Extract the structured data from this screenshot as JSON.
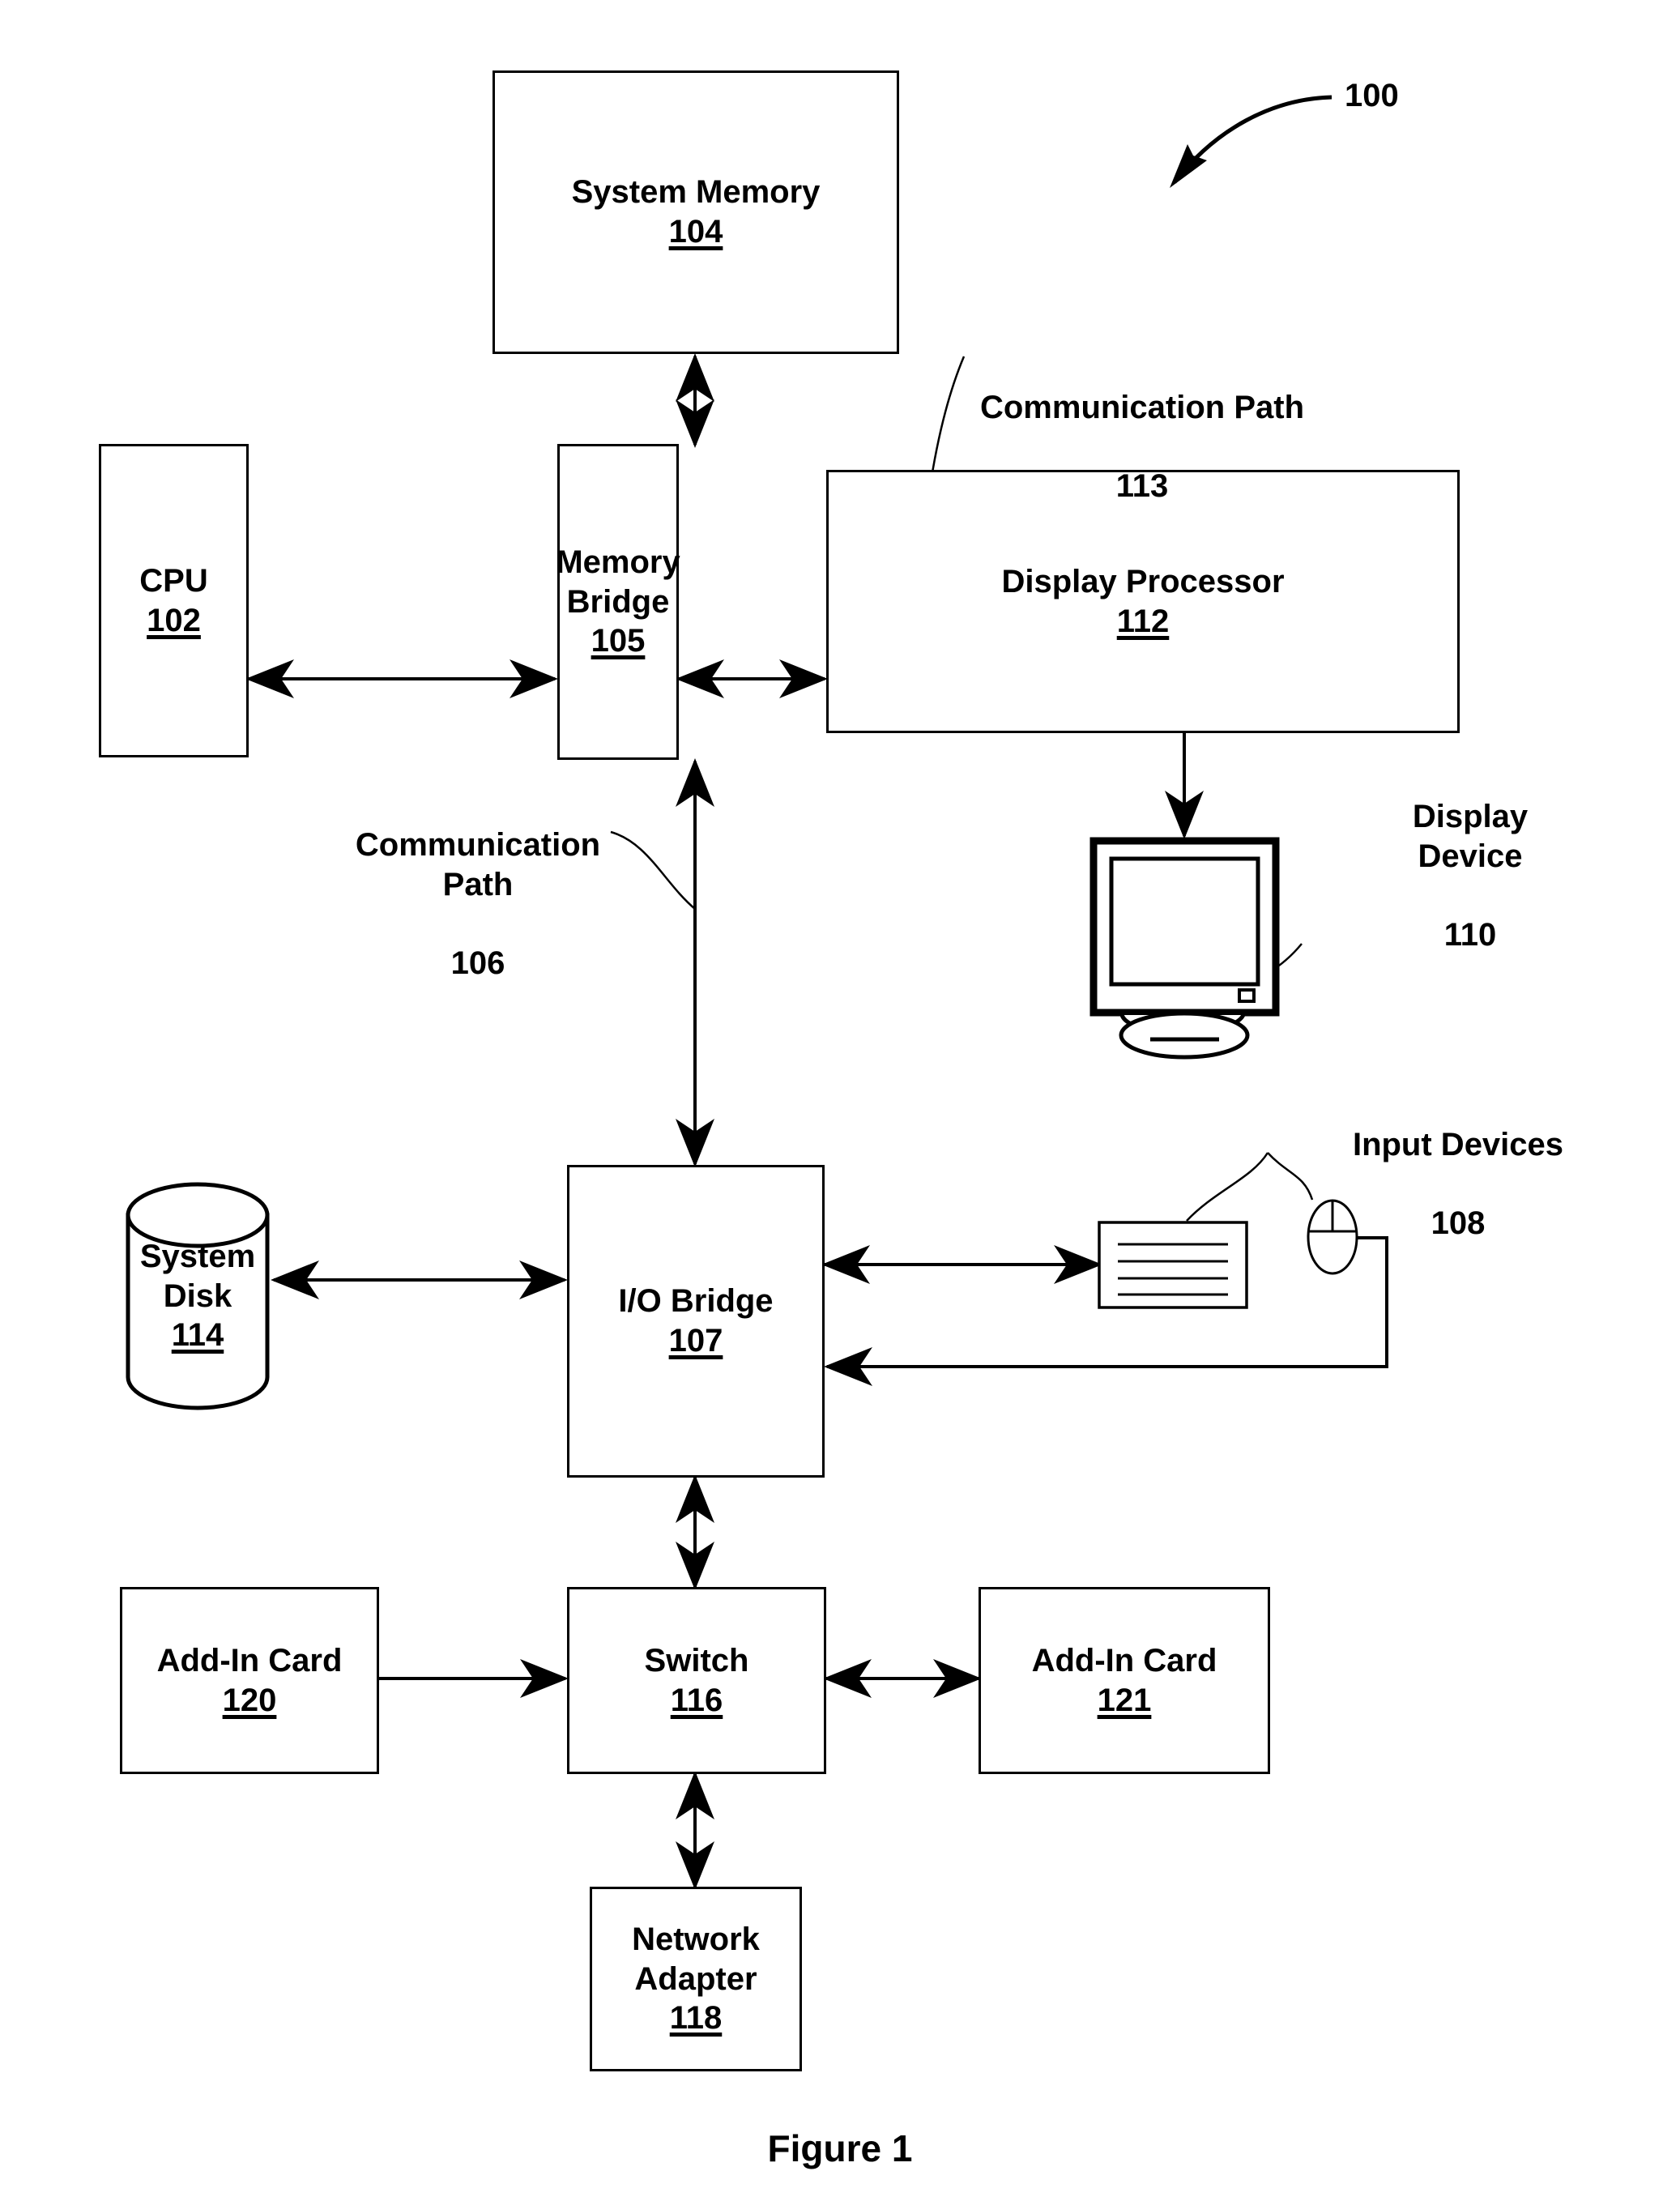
{
  "figure": {
    "caption": "Figure 1",
    "system_reference": "100"
  },
  "blocks": [
    {
      "id": "system-memory",
      "label": "System Memory",
      "number": "104"
    },
    {
      "id": "cpu",
      "label": "CPU",
      "number": "102"
    },
    {
      "id": "memory-bridge",
      "label": "Memory\nBridge",
      "number": "105"
    },
    {
      "id": "display-processor",
      "label": "Display Processor",
      "number": "112"
    },
    {
      "id": "io-bridge",
      "label": "I/O Bridge",
      "number": "107"
    },
    {
      "id": "system-disk",
      "label": "System\nDisk",
      "number": "114"
    },
    {
      "id": "switch",
      "label": "Switch",
      "number": "116"
    },
    {
      "id": "add-in-card-120",
      "label": "Add-In Card",
      "number": "120"
    },
    {
      "id": "add-in-card-121",
      "label": "Add-In Card",
      "number": "121"
    },
    {
      "id": "network-adapter",
      "label": "Network\nAdapter",
      "number": "118"
    }
  ],
  "annotations": [
    {
      "id": "communication-path-113",
      "label": "Communication Path",
      "number": "113"
    },
    {
      "id": "communication-path-106",
      "label": "Communication\nPath",
      "number": "106"
    },
    {
      "id": "display-device-110",
      "label": "Display\nDevice",
      "number": "110"
    },
    {
      "id": "input-devices-108",
      "label": "Input Devices",
      "number": "108"
    }
  ],
  "icons": {
    "monitor": "display-monitor-icon",
    "keyboard": "keyboard-icon",
    "mouse": "mouse-icon",
    "disk": "cylinder-disk-icon"
  },
  "colors": {
    "stroke": "#000000",
    "fill": "#ffffff",
    "text": "#000000"
  },
  "connections": [
    {
      "from": "memory-bridge",
      "to": "system-memory",
      "type": "bidirectional"
    },
    {
      "from": "cpu",
      "to": "memory-bridge",
      "type": "bidirectional"
    },
    {
      "from": "memory-bridge",
      "to": "display-processor",
      "type": "bidirectional"
    },
    {
      "from": "display-processor",
      "to": "display-device-110",
      "type": "unidirectional"
    },
    {
      "from": "memory-bridge",
      "to": "io-bridge",
      "type": "bidirectional"
    },
    {
      "from": "system-disk",
      "to": "io-bridge",
      "type": "bidirectional"
    },
    {
      "from": "io-bridge",
      "to": "keyboard",
      "type": "bidirectional"
    },
    {
      "from": "mouse",
      "to": "io-bridge",
      "type": "unidirectional"
    },
    {
      "from": "io-bridge",
      "to": "switch",
      "type": "bidirectional"
    },
    {
      "from": "add-in-card-120",
      "to": "switch",
      "type": "bidirectional"
    },
    {
      "from": "switch",
      "to": "add-in-card-121",
      "type": "bidirectional"
    },
    {
      "from": "switch",
      "to": "network-adapter",
      "type": "bidirectional"
    }
  ]
}
